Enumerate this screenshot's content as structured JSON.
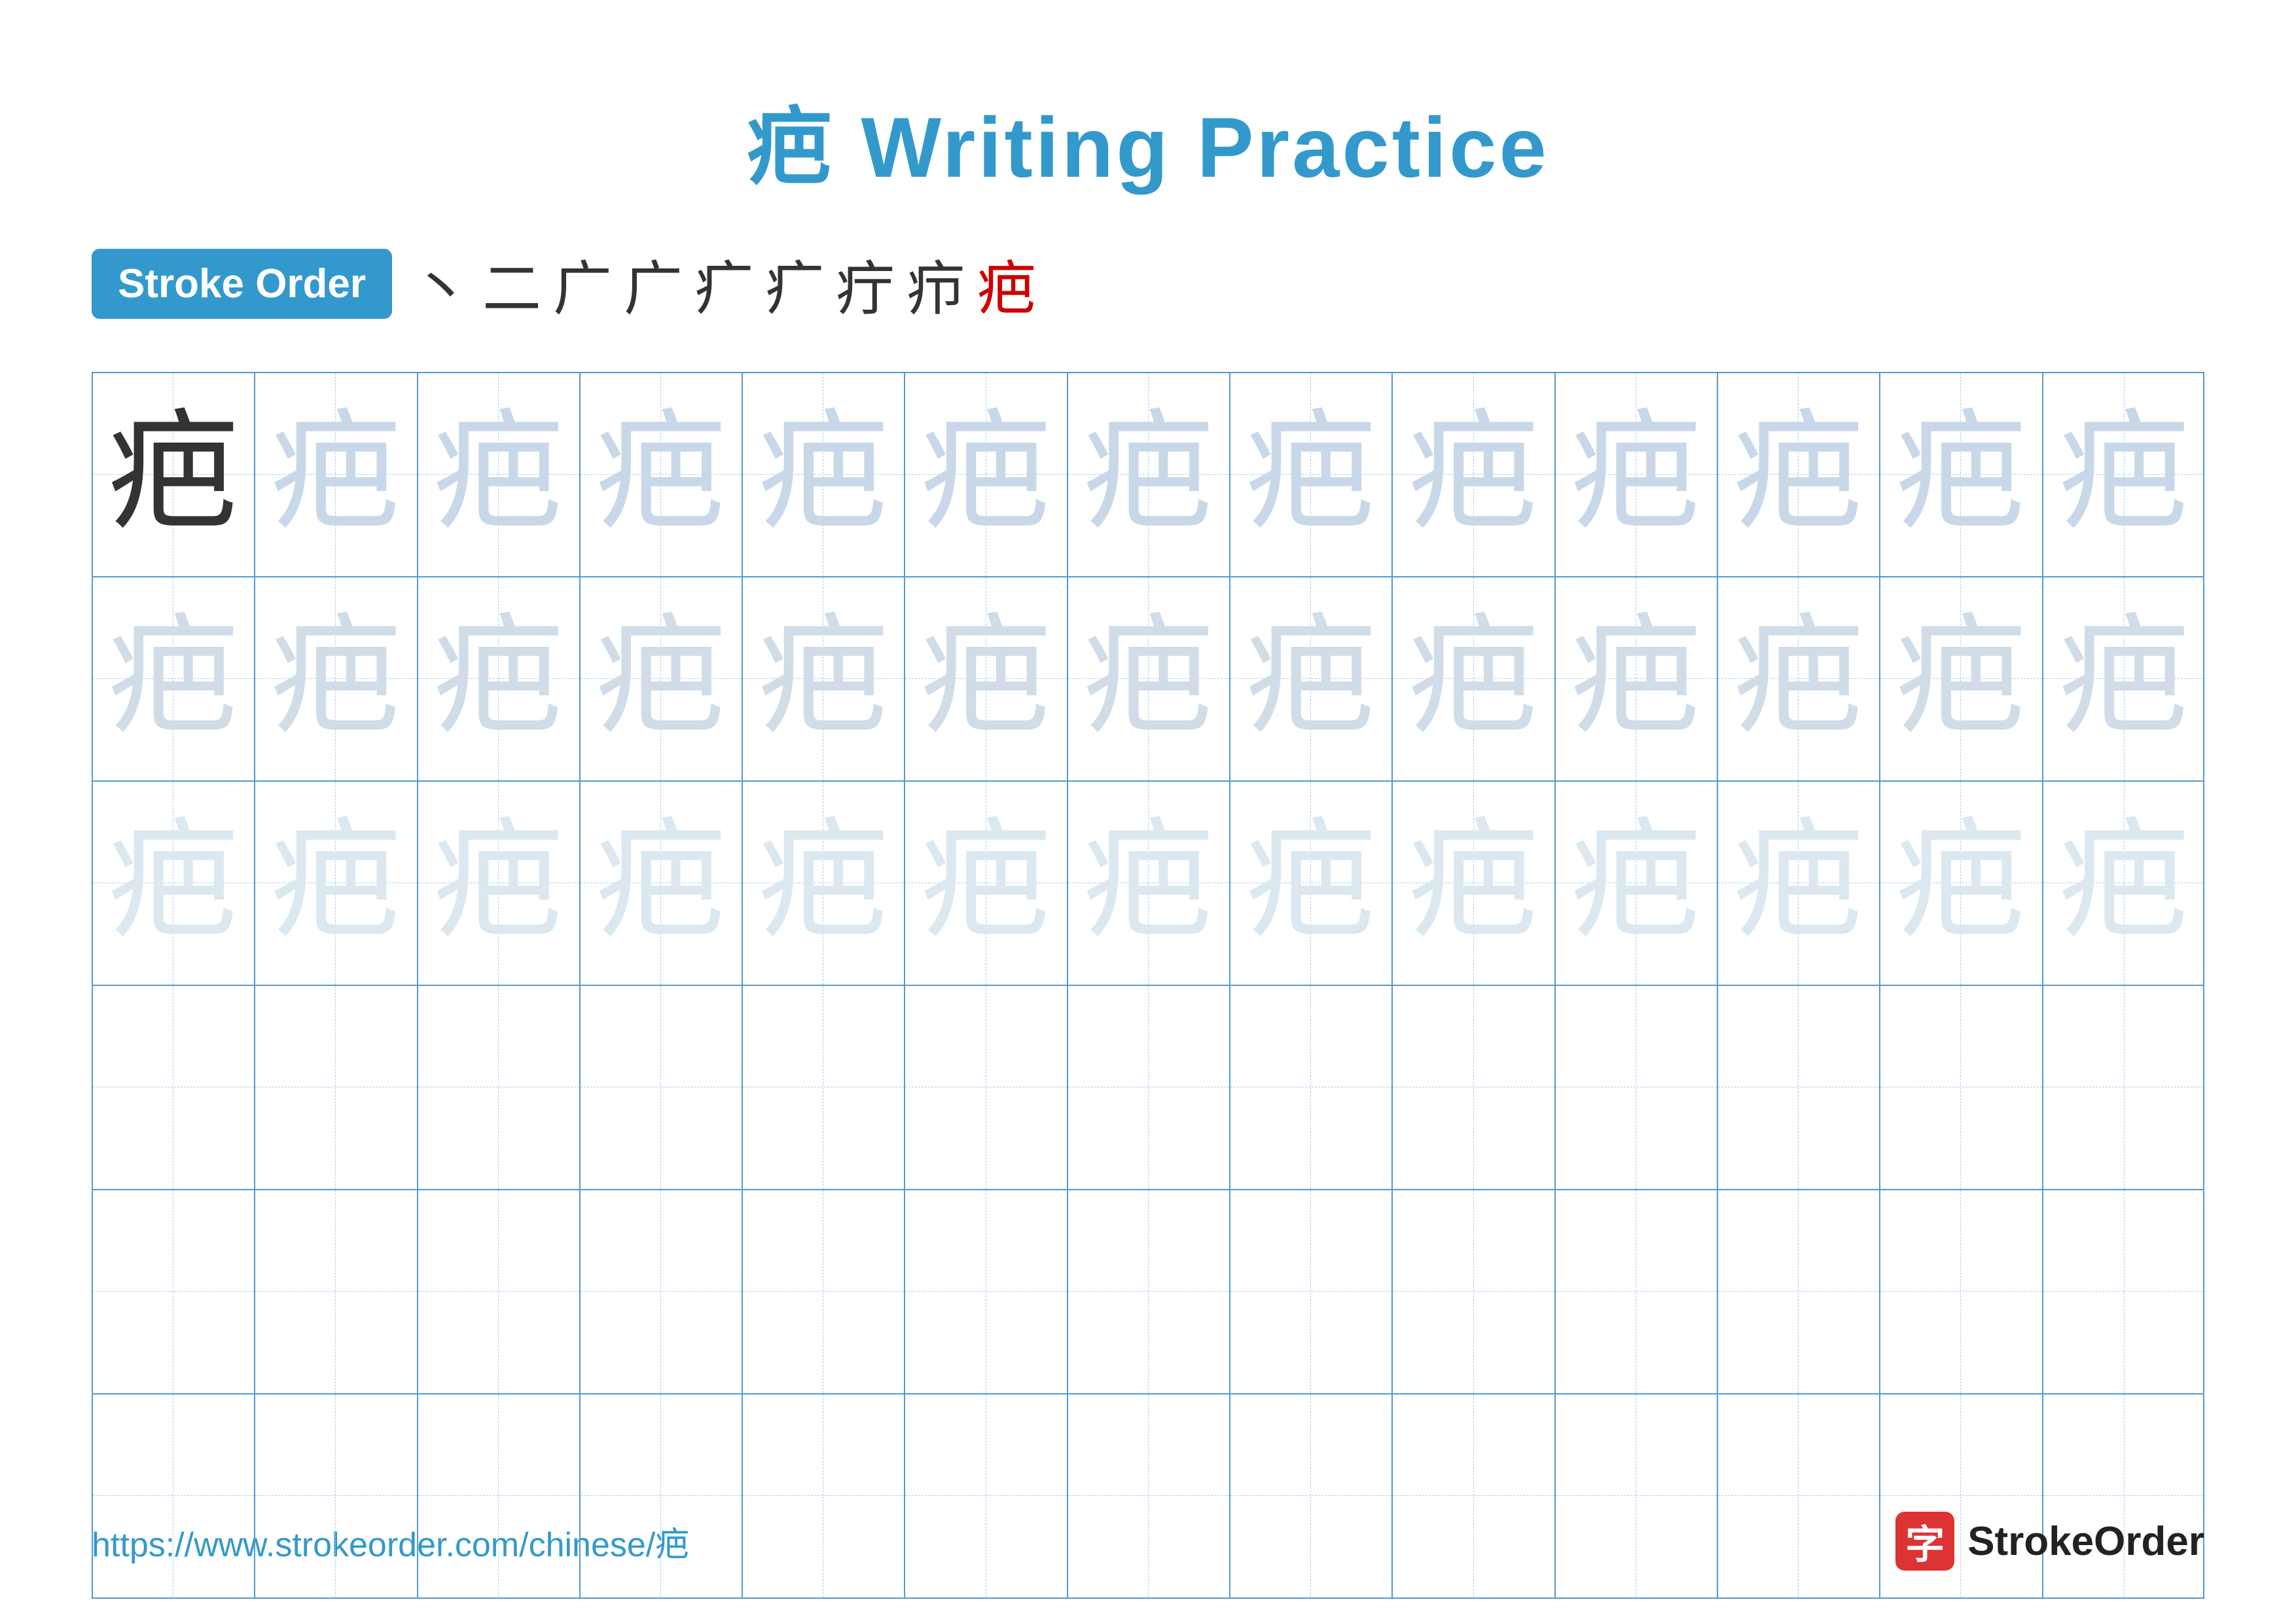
{
  "title": {
    "text": "疤 Writing Practice"
  },
  "stroke_order": {
    "badge_label": "Stroke Order",
    "strokes": [
      "丶",
      "二",
      "广",
      "广",
      "疒",
      "疒",
      "疔",
      "疖",
      "疤"
    ],
    "last_stroke_index": 8
  },
  "grid": {
    "character": "疤",
    "rows": 6,
    "cols": 13,
    "row_types": [
      "solid_then_light1",
      "light2",
      "light3",
      "empty",
      "empty",
      "empty"
    ]
  },
  "footer": {
    "url": "https://www.strokeorder.com/chinese/疤",
    "logo_char": "字",
    "logo_text": "StrokeOrder"
  }
}
